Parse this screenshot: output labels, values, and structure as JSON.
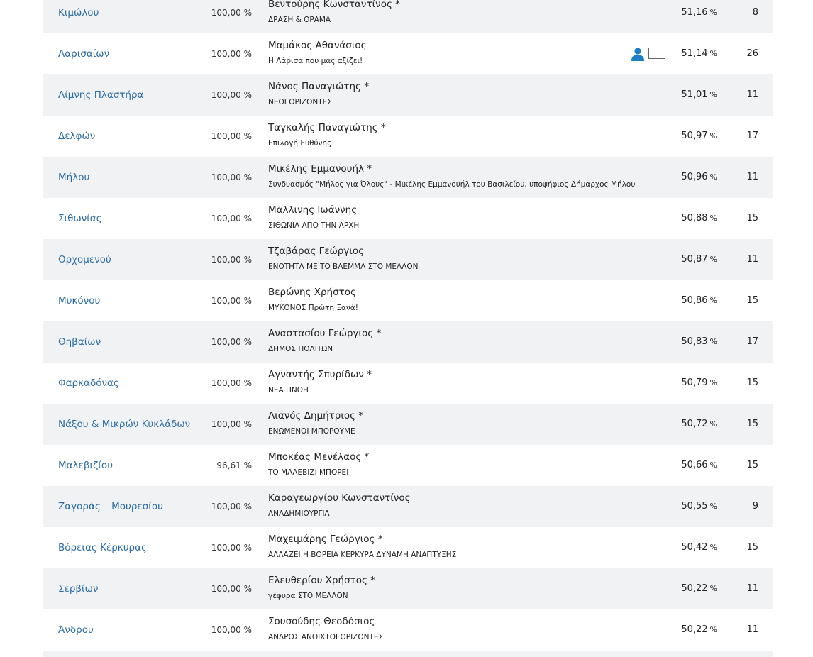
{
  "colors": {
    "link": "#2b6ca3",
    "row_alt": "#f0f2f4",
    "icon_accent": "#1a7fc4"
  },
  "rows": [
    {
      "municipality": "Κιμώλου",
      "counted": "100,00 %",
      "candidate": "Βεντούρης Κωνσταντίνος *",
      "party": "ΔΡΑΣΗ & ΟΡΑΜΑ",
      "percent": "51,16",
      "seats": "8"
    },
    {
      "municipality": "Λαρισαίων",
      "counted": "100,00 %",
      "candidate": "Μαμάκος Αθανάσιος",
      "party": "Η Λάρισα που μας αξίζει!",
      "percent": "51,14",
      "seats": "26",
      "icons": [
        "person-icon",
        "checkbox-icon"
      ]
    },
    {
      "municipality": "Λίμνης Πλαστήρα",
      "counted": "100,00 %",
      "candidate": "Νάνος Παναγιώτης *",
      "party": "ΝΕΟΙ ΟΡΙΖΟΝΤΕΣ",
      "percent": "51,01",
      "seats": "11"
    },
    {
      "municipality": "Δελφών",
      "counted": "100,00 %",
      "candidate": "Ταγκαλής Παναγιώτης *",
      "party": "Επιλογή Ευθύνης",
      "percent": "50,97",
      "seats": "17"
    },
    {
      "municipality": "Μήλου",
      "counted": "100,00 %",
      "candidate": "Μικέλης Εμμανουήλ *",
      "party": "Συνδυασμός \"Μήλος για Όλους\" - Μικέλης Εμμανουήλ του Βασιλείου, υποψήφιος Δήμαρχος Μήλου",
      "percent": "50,96",
      "seats": "11"
    },
    {
      "municipality": "Σιθωνίας",
      "counted": "100,00 %",
      "candidate": "Μαλλινης Ιωάννης",
      "party": "ΣΙΘΩΝΙΑ ΑΠΟ ΤΗΝ ΑΡΧΗ",
      "percent": "50,88",
      "seats": "15"
    },
    {
      "municipality": "Ορχομενού",
      "counted": "100,00 %",
      "candidate": "Τζαβάρας Γεώργιος",
      "party": "ΕΝΟΤΗΤΑ ΜΕ ΤΟ ΒΛΕΜΜΑ ΣΤΟ ΜΕΛΛΟΝ",
      "percent": "50,87",
      "seats": "11"
    },
    {
      "municipality": "Μυκόνου",
      "counted": "100,00 %",
      "candidate": "Βερώνης Χρήστος",
      "party": "ΜΥΚΟΝΟΣ Πρώτη Ξανά!",
      "percent": "50,86",
      "seats": "15"
    },
    {
      "municipality": "Θηβαίων",
      "counted": "100,00 %",
      "candidate": "Αναστασίου Γεώργιος *",
      "party": "ΔΗΜΟΣ ΠΟΛΙΤΩΝ",
      "percent": "50,83",
      "seats": "17"
    },
    {
      "municipality": "Φαρκαδόνας",
      "counted": "100,00 %",
      "candidate": "Αγναντής Σπυρίδων *",
      "party": "ΝΕΑ ΠΝΟΗ",
      "percent": "50,79",
      "seats": "15"
    },
    {
      "municipality": "Νάξου & Μικρών Κυκλάδων",
      "counted": "100,00 %",
      "candidate": "Λιανός Δημήτριος *",
      "party": "ΕΝΩΜΕΝΟΙ ΜΠΟΡΟΥΜΕ",
      "percent": "50,72",
      "seats": "15"
    },
    {
      "municipality": "Μαλεβιζίου",
      "counted": "96,61 %",
      "candidate": "Μποκέας Μενέλαος  *",
      "party": "ΤΟ ΜΑΛΕΒΙΖΙ ΜΠΟΡΕΙ",
      "percent": "50,66",
      "seats": "15"
    },
    {
      "municipality": "Ζαγοράς – Μουρεσίου",
      "counted": "100,00 %",
      "candidate": "Καραγεωργίου Κωνσταντίνος",
      "party": "ΑΝΑΔΗΜΙΟΥΡΓΙΑ",
      "percent": "50,55",
      "seats": "9"
    },
    {
      "municipality": "Βόρειας Κέρκυρας",
      "counted": "100,00 %",
      "candidate": "Μαχειμάρης Γεώργιος *",
      "party": "ΑΛΛΑΖΕΙ Η ΒΟΡΕΙΑ ΚΕΡΚΥΡΑ ΔΥΝΑΜΗ ΑΝΑΠΤΥΞΗΣ",
      "percent": "50,42",
      "seats": "15"
    },
    {
      "municipality": "Σερβίων",
      "counted": "100,00 %",
      "candidate": "Ελευθερίου Χρήστος *",
      "party": "γέφυρα ΣΤΟ ΜΕΛΛΟΝ",
      "percent": "50,22",
      "seats": "11"
    },
    {
      "municipality": "Άνδρου",
      "counted": "100,00 %",
      "candidate": "Σουσούδης Θεοδόσιος",
      "party": "ΑΝΔΡΟΣ ΑΝΟΙΧΤΟΙ ΟΡΙΖΟΝΤΕΣ",
      "percent": "50,22",
      "seats": "11"
    }
  ],
  "percent_symbol": "%"
}
